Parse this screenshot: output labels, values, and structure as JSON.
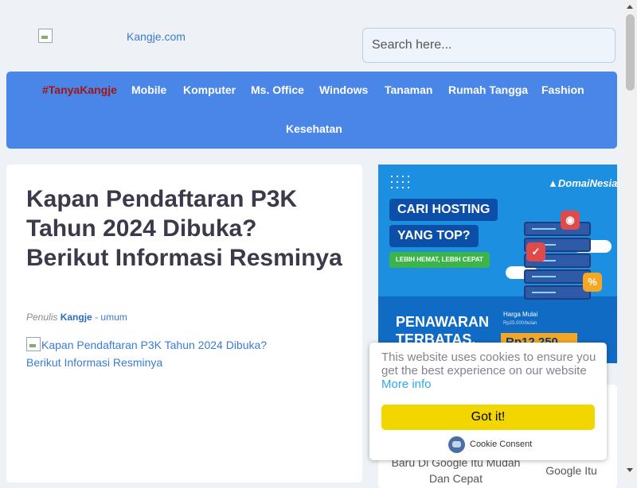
{
  "header": {
    "logo_alt": "Kangje.com",
    "search_placeholder": "Search here..."
  },
  "nav": {
    "items": [
      "#TanyaKangje",
      "Mobile",
      "Komputer",
      "Ms. Office",
      "Windows",
      "Tanaman",
      "Rumah Tangga",
      "Fashion",
      "Kesehatan"
    ]
  },
  "article": {
    "title": "Kapan Pendaftaran P3K Tahun 2024 Dibuka? Berikut Informasi Resminya",
    "meta_prefix": "Penulis",
    "author": "Kangje",
    "separator": "-",
    "category": "umum",
    "image_alt": "Kapan Pendaftaran P3K Tahun 2024 Dibuka? Berikut Informasi Resminya"
  },
  "ad": {
    "brand": "DomaiNesia",
    "headline_1": "CARI HOSTING",
    "headline_2": "YANG TOP?",
    "tagline": "LEBIH HEMAT, LEBIH CEPAT",
    "offer_1": "PENAWARAN",
    "offer_2": "TERBATAS.",
    "price_label": "Harga Mulai",
    "price_old": "Rp25.000/bulan",
    "price": "Rp12.250"
  },
  "sidebar": {
    "related_a": "Baru Di Google Itu Mudah Dan Cepat",
    "related_b": "Google Itu"
  },
  "cookie": {
    "message": "This website uses cookies to ensure you get the best experience on our website",
    "more_info": "More info",
    "button": "Got it!",
    "brand": "Cookie Consent"
  },
  "colors": {
    "nav_bg": "#4a86e8",
    "nav_hashtag": "#a31515",
    "link": "#3a7bd5",
    "cookie_button": "#f1d600",
    "cookie_link": "#31a8f0"
  }
}
